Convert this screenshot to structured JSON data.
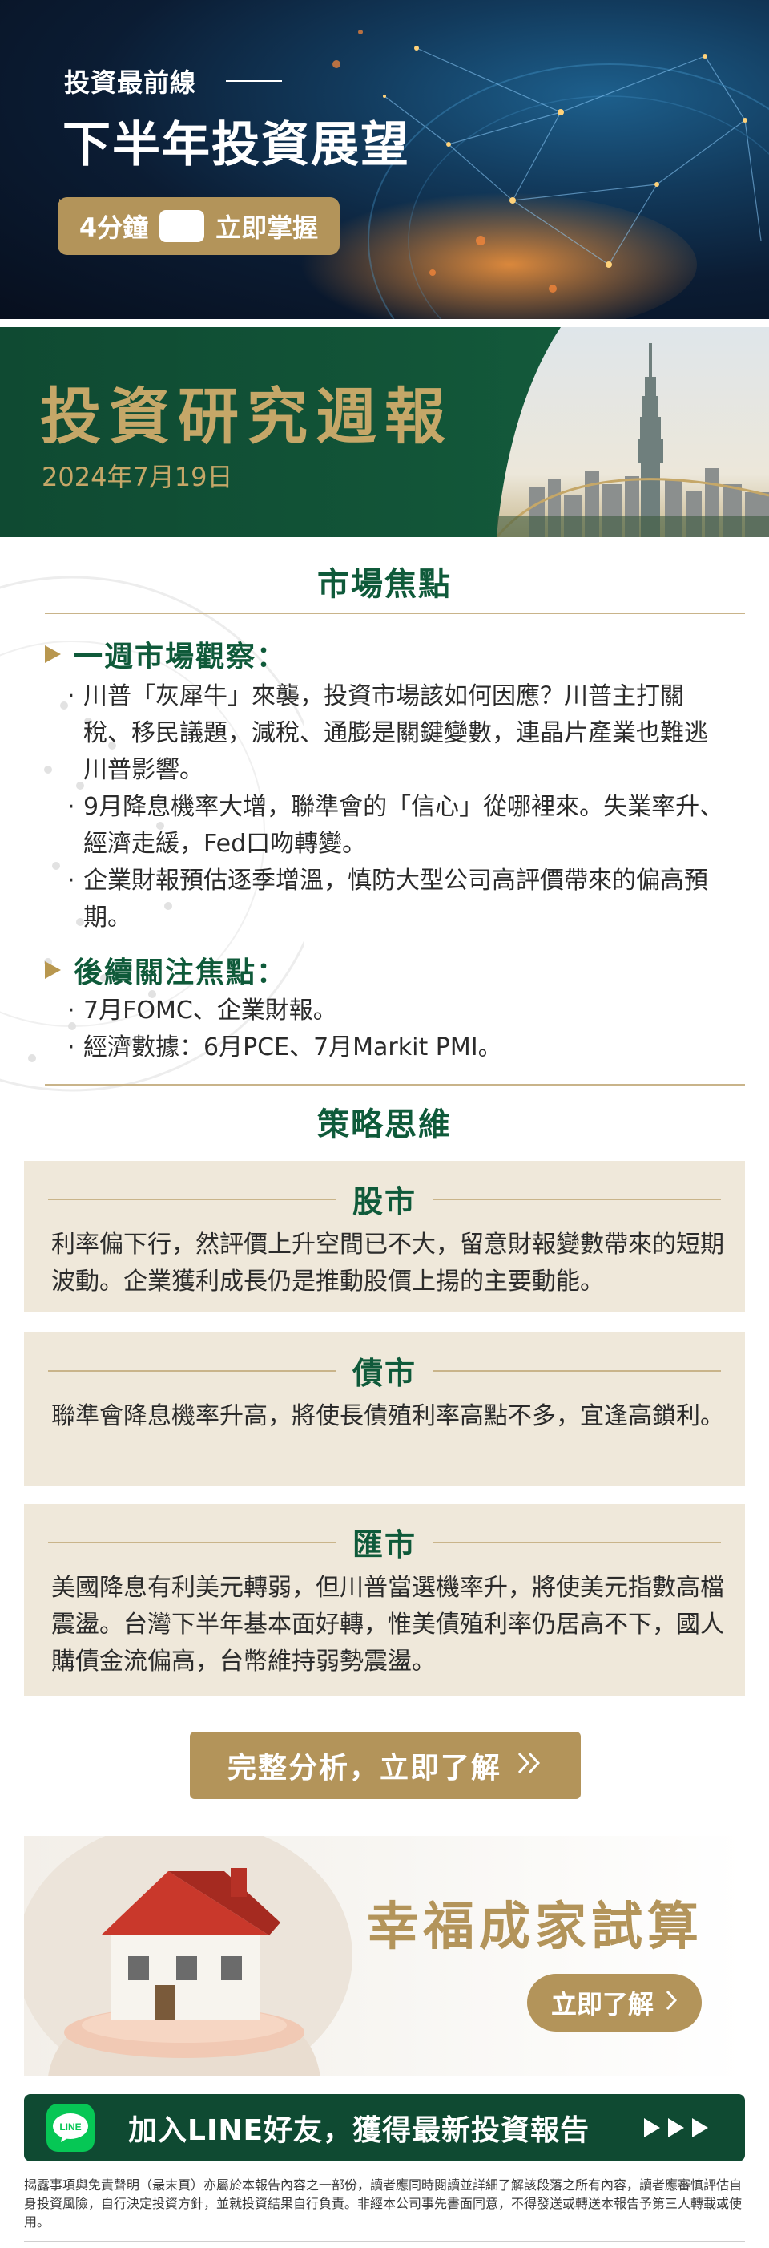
{
  "hero": {
    "eyebrow": "投資最前線",
    "title": "下半年投資展望",
    "cta_duration": "4分鐘",
    "cta_label": "立即掌握",
    "icon": "play-icon"
  },
  "weekly": {
    "title": "投資研究週報",
    "date": "2024年7月19日"
  },
  "market_focus": {
    "heading": "市場焦點",
    "weekly_observation": {
      "title": "一週市場觀察：",
      "bullets": [
        "川普「灰犀牛」來襲，投資市場該如何因應？川普主打關稅、移民議題，減稅、通膨是關鍵變數，連晶片產業也難逃川普影響。",
        "9月降息機率大增，聯準會的「信心」從哪裡來。失業率升、經濟走緩，Fed口吻轉變。",
        "企業財報預估逐季增溫，慎防大型公司高評價帶來的偏高預期。"
      ]
    },
    "follow_up": {
      "title": "後續關注焦點：",
      "bullets": [
        "7月FOMC、企業財報。",
        "經濟數據：6月PCE、7月Markit PMI。"
      ]
    }
  },
  "strategy": {
    "heading": "策略思維",
    "cards": [
      {
        "title": "股市",
        "body": "利率偏下行，然評價上升空間已不大，留意財報變數帶來的短期波動。企業獲利成長仍是推動股價上揚的主要動能。"
      },
      {
        "title": "債市",
        "body": "聯準會降息機率升高，將使長債殖利率高點不多，宜逢高鎖利。"
      },
      {
        "title": "匯市",
        "body": "美國降息有利美元轉弱，但川普當選機率升，將使美元指數高檔震盪。台灣下半年基本面好轉，惟美債殖利率仍居高不下，國人購債金流偏高，台幣維持弱勢震盪。"
      }
    ]
  },
  "full_analysis": {
    "label": "完整分析，立即了解",
    "icon": "double-chevron-right-icon"
  },
  "home_calc": {
    "title": "幸福成家試算",
    "button": "立即了解",
    "icon": "chevron-right-icon"
  },
  "line_bar": {
    "logo_text": "LINE",
    "label": "加入LINE好友，獲得最新投資報告"
  },
  "disclaimer": "揭露事項與免責聲明（最末頁）亦屬於本報告內容之一部份，讀者應同時閱讀並詳細了解該段落之所有內容，讀者應審慎評估自身投資風險，自行決定投資方針，並就投資結果自行負責。非經本公司事先書面同意，不得發送或轉送本報告予第三人轉載或使用。",
  "colors": {
    "green": "#0f5a3a",
    "gold": "#b3945a",
    "beige": "#efe8da",
    "line_green": "#06c755"
  }
}
